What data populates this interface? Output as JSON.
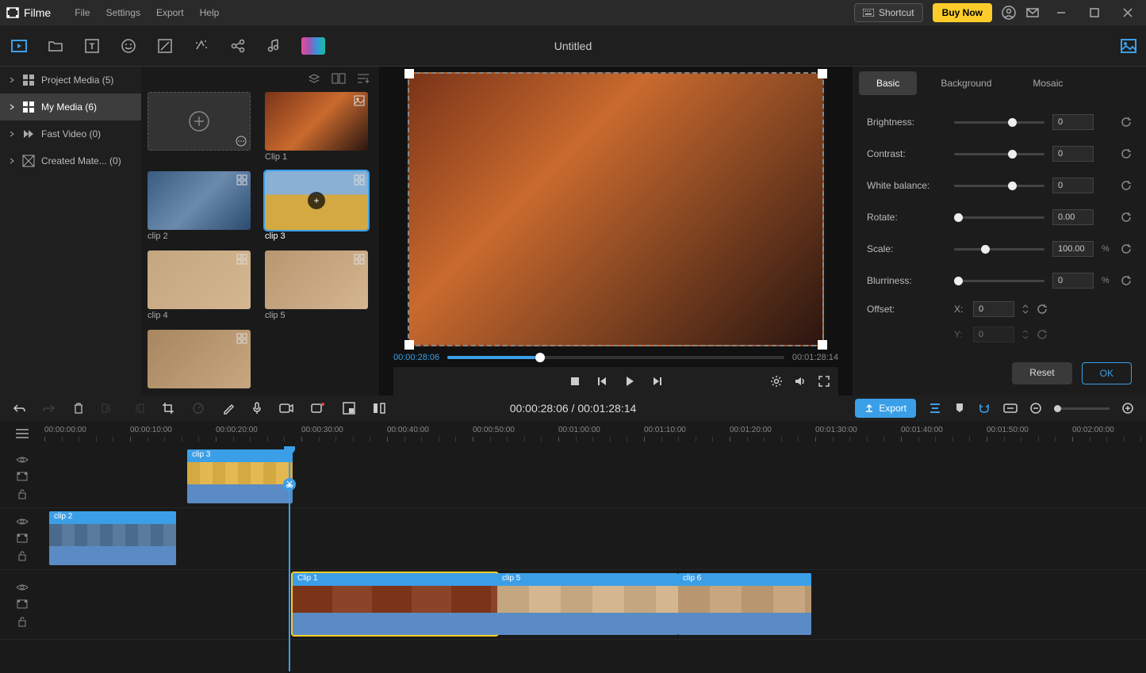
{
  "title": "Filme",
  "menu": [
    "File",
    "Settings",
    "Export",
    "Help"
  ],
  "shortcut": "Shortcut",
  "buy": "Buy Now",
  "document": "Untitled",
  "sidebar": [
    {
      "label": "Project Media (5)"
    },
    {
      "label": "My Media (6)"
    },
    {
      "label": "Fast Video (0)"
    },
    {
      "label": "Created Mate... (0)"
    }
  ],
  "thumbs": [
    {
      "label": "Clip 1",
      "sel": false
    },
    {
      "label": "clip 2",
      "sel": false
    },
    {
      "label": "clip 3",
      "sel": true
    },
    {
      "label": "clip 4",
      "sel": false
    },
    {
      "label": "clip 5",
      "sel": false
    }
  ],
  "preview": {
    "current": "00:00:28:06",
    "total": "00:01:28:14",
    "pos": 26
  },
  "tabs": [
    "Basic",
    "Background",
    "Mosaic"
  ],
  "props": {
    "brightness": {
      "label": "Brightness:",
      "val": "0",
      "knob": 60
    },
    "contrast": {
      "label": "Contrast:",
      "val": "0",
      "knob": 60
    },
    "wb": {
      "label": "White balance:",
      "val": "0",
      "knob": 60
    },
    "rotate": {
      "label": "Rotate:",
      "val": "0.00",
      "knob": 0
    },
    "scale": {
      "label": "Scale:",
      "val": "100.00",
      "unit": "%",
      "knob": 30
    },
    "blur": {
      "label": "Blurriness:",
      "val": "0",
      "unit": "%",
      "knob": 0
    },
    "offset": {
      "label": "Offset:",
      "x_lbl": "X:",
      "x": "0",
      "y_lbl": "Y:",
      "y": "0"
    }
  },
  "buttons": {
    "reset": "Reset",
    "ok": "OK"
  },
  "timeline": {
    "current": "00:00:28:06",
    "total": "00:01:28:14",
    "export": "Export",
    "ticks": [
      "00:00:00:00",
      "00:00:10:00",
      "00:00:20:00",
      "00:00:30:00",
      "00:00:40:00",
      "00:00:50:00",
      "00:01:00:00",
      "00:01:10:00",
      "00:01:20:00",
      "00:01:30:00",
      "00:01:40:00",
      "00:01:50:00",
      "00:02:00:00"
    ]
  },
  "clips": {
    "t1": {
      "name": "clip 3"
    },
    "t2": {
      "name": "clip 2"
    },
    "t3a": {
      "name": "Clip 1"
    },
    "t3b": {
      "name": "clip 5"
    },
    "t3c": {
      "name": "clip 6"
    }
  }
}
